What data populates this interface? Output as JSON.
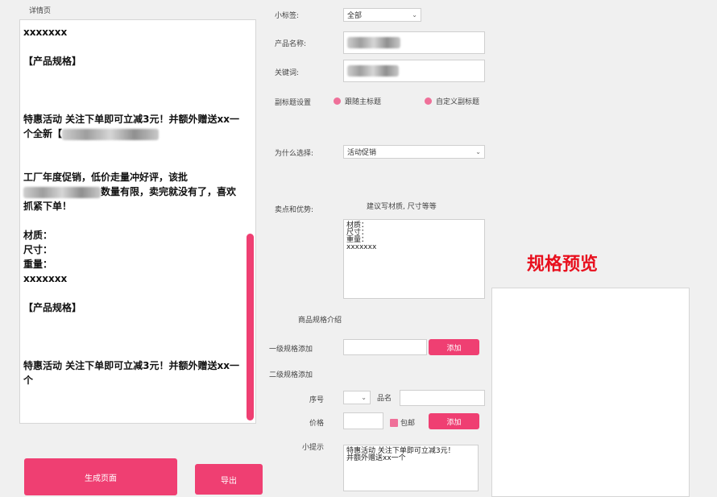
{
  "left_panel": {
    "title": "详情页",
    "lines": [
      "xxxxxxx",
      "",
      "【产品规格】",
      "",
      "",
      "",
      "特惠活动 关注下单即可立减3元！并额外赠送xx一个全新【",
      "",
      "",
      "工厂年度促销，低价走量冲好评，该批",
      "数量有限，卖完就没有了，喜欢抓紧下单！",
      "",
      "材质：",
      "尺寸：",
      "重量：",
      "xxxxxxx",
      "",
      "【产品规格】",
      "",
      "",
      "",
      "特惠活动 关注下单即可立减3元！并额外赠送xx一个"
    ],
    "generate_button": "生成页面",
    "export_button": "导出"
  },
  "form": {
    "category_label": "小标签:",
    "category_value": "全部",
    "product_name_label": "产品名称:",
    "keyword_label": "关键词:",
    "subtitle_setting_label": "副标题设置",
    "subtitle_option1": "跟随主标题",
    "subtitle_option2": "自定义副标题",
    "why_choose_label": "为什么选择:",
    "why_choose_value": "活动促销",
    "features_label": "卖点和优势:",
    "features_hint": "建议写材质, 尺寸等等",
    "features_text": "材质：\n尺寸：\n重量：\nxxxxxxx",
    "spec_intro_label": "商品规格介绍",
    "level1_label": "一级规格添加",
    "level1_add": "添加",
    "level2_label": "二级规格添加",
    "seq_label": "序号",
    "name_label": "品名",
    "price_label": "价格",
    "package_label": "包邮",
    "level2_add": "添加",
    "notice_label": "小提示",
    "notice_text": "特惠活动 关注下单即可立减3元！\n并额外赠送xx一个"
  },
  "right_panel": {
    "title": "规格预览"
  },
  "colors": {
    "accent": "#ef3f72",
    "title_red": "#e8101e",
    "background": "#f0f0f0"
  }
}
